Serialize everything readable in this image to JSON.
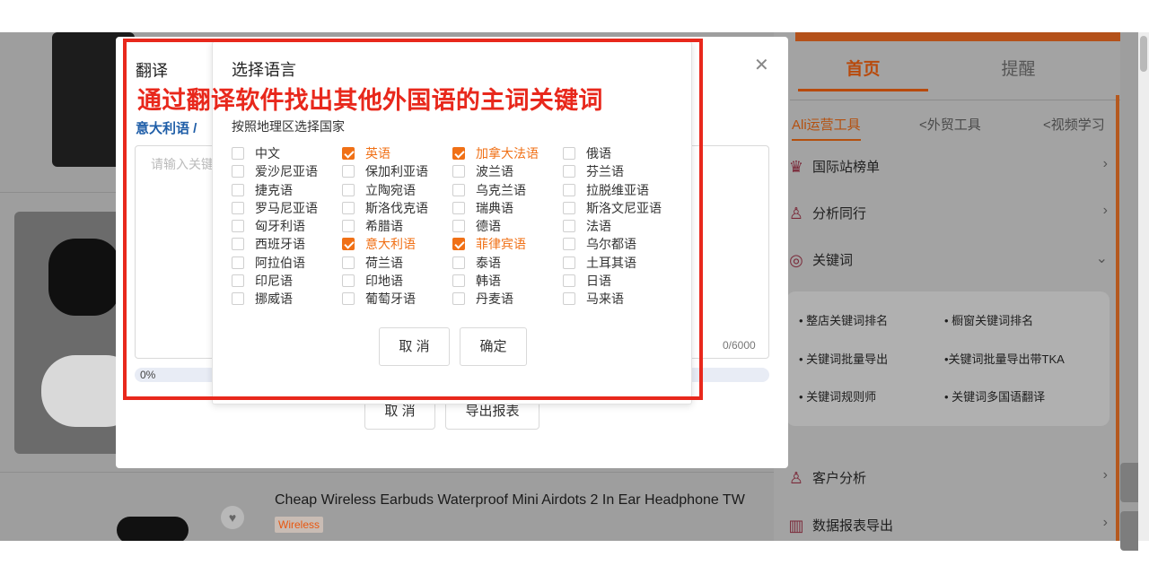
{
  "background": {
    "product": {
      "title": "Cheap Wireless Earbuds Waterproof Mini Airdots 2 In Ear Headphone TW",
      "tag": "Wireless"
    }
  },
  "right_panel": {
    "tabs": {
      "home": "首页",
      "remind": "提醒"
    },
    "subtabs": {
      "ali": "Ali运营工具",
      "trade": "<外贸工具",
      "video": "<视频学习"
    },
    "menu": [
      {
        "label": "国际站榜单",
        "icon": "ranking-icon"
      },
      {
        "label": "分析同行",
        "icon": "user-analysis-icon"
      },
      {
        "label": "关键词",
        "icon": "target-icon"
      },
      {
        "label": "客户分析",
        "icon": "customer-icon"
      },
      {
        "label": "数据报表导出",
        "icon": "bar-chart-icon"
      }
    ],
    "keyword_tools": [
      "• 整店关键词排名",
      "• 橱窗关键词排名",
      "• 关键词批量导出",
      "•关键词批量导出带TKA",
      "• 关键词规则师",
      "• 关键词多国语翻译"
    ]
  },
  "translate_modal": {
    "title": "翻译",
    "crumb": "意大利语 /",
    "textarea_placeholder": "请输入关键",
    "char_count": "0/6000",
    "progress": "0%",
    "progress_value": 0,
    "cancel": "取 消",
    "export": "导出报表"
  },
  "language_popup": {
    "title": "选择语言",
    "subtitle": "按照地理区选择国家",
    "columns": [
      [
        {
          "label": "中文",
          "checked": false
        },
        {
          "label": "爱沙尼亚语",
          "checked": false
        },
        {
          "label": "捷克语",
          "checked": false
        },
        {
          "label": "罗马尼亚语",
          "checked": false
        },
        {
          "label": "匈牙利语",
          "checked": false
        },
        {
          "label": "西班牙语",
          "checked": false
        },
        {
          "label": "阿拉伯语",
          "checked": false
        },
        {
          "label": "印尼语",
          "checked": false
        },
        {
          "label": "挪威语",
          "checked": false
        }
      ],
      [
        {
          "label": "英语",
          "checked": true
        },
        {
          "label": "保加利亚语",
          "checked": false
        },
        {
          "label": "立陶宛语",
          "checked": false
        },
        {
          "label": "斯洛伐克语",
          "checked": false
        },
        {
          "label": "希腊语",
          "checked": false
        },
        {
          "label": "意大利语",
          "checked": true
        },
        {
          "label": "荷兰语",
          "checked": false
        },
        {
          "label": "印地语",
          "checked": false
        },
        {
          "label": "葡萄牙语",
          "checked": false
        }
      ],
      [
        {
          "label": "加拿大法语",
          "checked": true
        },
        {
          "label": "波兰语",
          "checked": false
        },
        {
          "label": "乌克兰语",
          "checked": false
        },
        {
          "label": "瑞典语",
          "checked": false
        },
        {
          "label": "德语",
          "checked": false
        },
        {
          "label": "菲律宾语",
          "checked": true
        },
        {
          "label": "泰语",
          "checked": false
        },
        {
          "label": "韩语",
          "checked": false
        },
        {
          "label": "丹麦语",
          "checked": false
        }
      ],
      [
        {
          "label": "俄语",
          "checked": false
        },
        {
          "label": "芬兰语",
          "checked": false
        },
        {
          "label": "拉脱维亚语",
          "checked": false
        },
        {
          "label": "斯洛文尼亚语",
          "checked": false
        },
        {
          "label": "法语",
          "checked": false
        },
        {
          "label": "乌尔都语",
          "checked": false
        },
        {
          "label": "土耳其语",
          "checked": false
        },
        {
          "label": "日语",
          "checked": false
        },
        {
          "label": "马来语",
          "checked": false
        }
      ]
    ],
    "cancel": "取 消",
    "confirm": "确定"
  },
  "annotation": {
    "text": "通过翻译软件找出其他外国语的主词关键词",
    "color": "#e8281c"
  },
  "colors": {
    "accent": "#f07016",
    "link": "#1f5ea8"
  }
}
